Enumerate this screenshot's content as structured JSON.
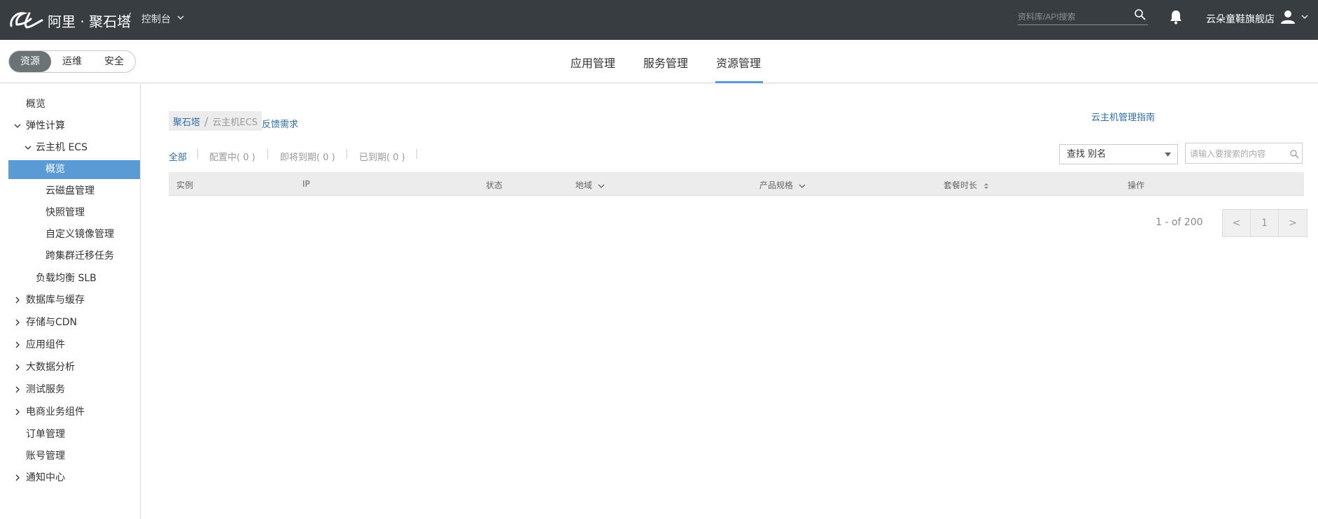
{
  "topbar": {
    "brand": "阿里 · 聚石塔",
    "separator": "/",
    "console_label": "控制台",
    "search_placeholder": "资料库/API搜索",
    "shop_name": "云朵童鞋旗舰店",
    "background": "#373d41"
  },
  "subbar": {
    "segments": [
      "资源",
      "运维",
      "安全"
    ],
    "active_segment": "资源",
    "tabs": [
      "应用管理",
      "服务管理",
      "资源管理"
    ],
    "active_tab": "资源管理",
    "accent": "#5a9bd5"
  },
  "sidebar": {
    "items": [
      {
        "label": "概览",
        "expandable": false
      },
      {
        "label": "弹性计算",
        "expanded": true
      },
      {
        "label": "云主机 ECS",
        "expanded": true
      },
      {
        "label": "概览",
        "active": true
      },
      {
        "label": "云磁盘管理"
      },
      {
        "label": "快照管理"
      },
      {
        "label": "自定义镜像管理"
      },
      {
        "label": "跨集群迁移任务"
      },
      {
        "label": "负载均衡 SLB"
      },
      {
        "label": "数据库与缓存",
        "expanded": false
      },
      {
        "label": "存储与CDN",
        "expanded": false
      },
      {
        "label": "应用组件",
        "expanded": false
      },
      {
        "label": "大数据分析",
        "expanded": false
      },
      {
        "label": "测试服务",
        "expanded": false
      },
      {
        "label": "电商业务组件",
        "expanded": false
      },
      {
        "label": "订单管理"
      },
      {
        "label": "账号管理"
      },
      {
        "label": "通知中心",
        "expanded": false
      }
    ]
  },
  "main": {
    "breadcrumb": {
      "root": "聚石塔",
      "sep": "/",
      "current": "云主机ECS"
    },
    "feedback_link": "反馈需求",
    "guide_link": "云主机管理指南",
    "filters": [
      "全部",
      "配置中( 0 )",
      "即将到期( 0 )",
      "已到期( 0 )"
    ],
    "active_filter": "全部",
    "select_value": "查找 别名",
    "search_placeholder": "请输入要搜索的内容",
    "columns": [
      "实例",
      "IP",
      "状态",
      "地域",
      "产品规格",
      "套餐时长",
      "操作"
    ],
    "pager_text": "1 - of 200",
    "pager": {
      "prev": "<",
      "page": "1",
      "next": ">"
    }
  }
}
